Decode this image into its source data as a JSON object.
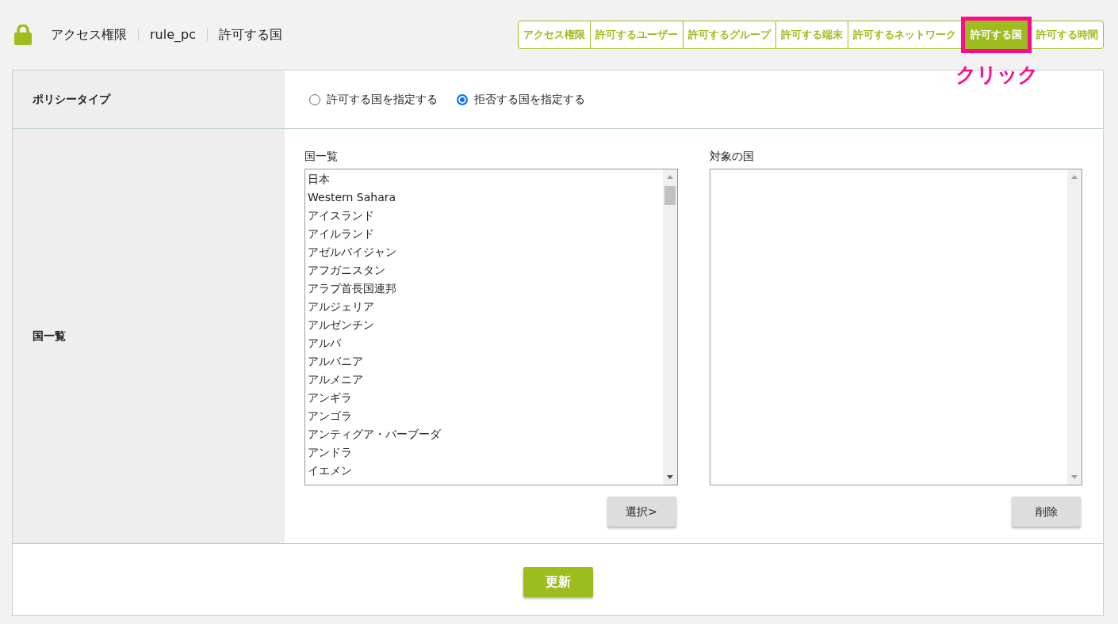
{
  "breadcrumb": [
    "アクセス権限",
    "rule_pc",
    "許可する国"
  ],
  "tabs": [
    {
      "label": "アクセス権限",
      "selected": false
    },
    {
      "label": "許可するユーザー",
      "selected": false
    },
    {
      "label": "許可するグループ",
      "selected": false
    },
    {
      "label": "許可する端末",
      "selected": false
    },
    {
      "label": "許可するネットワーク",
      "selected": false
    },
    {
      "label": "許可する国",
      "selected": true,
      "highlighted": true
    },
    {
      "label": "許可する時間",
      "selected": false
    }
  ],
  "annotation": {
    "text": "クリック"
  },
  "policy_type": {
    "label": "ポリシータイプ",
    "options": [
      {
        "label": "許可する国を指定する",
        "selected": false
      },
      {
        "label": "拒否する国を指定する",
        "selected": true
      }
    ]
  },
  "country_section": {
    "label": "国一覧",
    "source_list": {
      "title": "国一覧",
      "items": [
        "日本",
        "Western Sahara",
        "アイスランド",
        "アイルランド",
        "アゼルバイジャン",
        "アフガニスタン",
        "アラブ首長国連邦",
        "アルジェリア",
        "アルゼンチン",
        "アルバ",
        "アルバニア",
        "アルメニア",
        "アンギラ",
        "アンゴラ",
        "アンティグア・バーブーダ",
        "アンドラ",
        "イエメン"
      ],
      "button": "選択>"
    },
    "target_list": {
      "title": "対象の国",
      "button": "削除"
    }
  },
  "submit_button": "更新"
}
